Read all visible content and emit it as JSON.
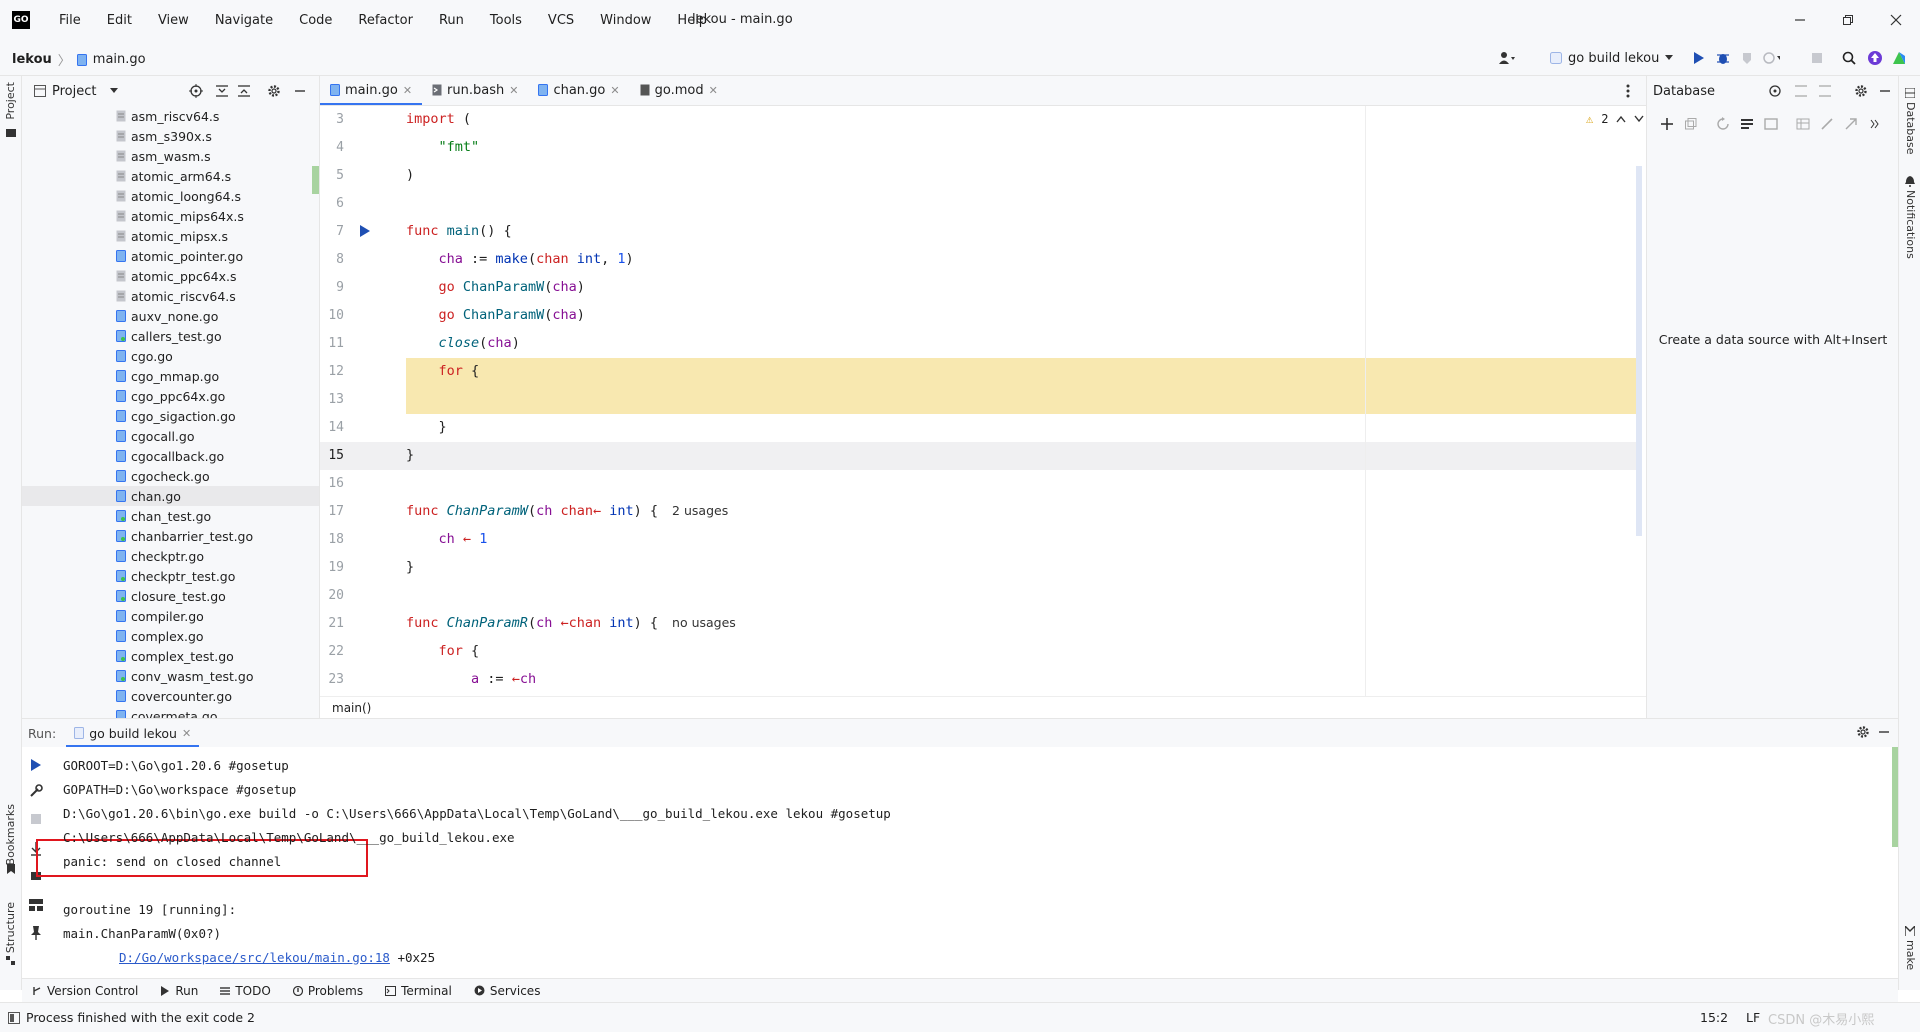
{
  "menu": {
    "items": [
      "File",
      "Edit",
      "View",
      "Navigate",
      "Code",
      "Refactor",
      "Run",
      "Tools",
      "VCS",
      "Window",
      "Help"
    ],
    "logo_text": "GO"
  },
  "window": {
    "title": "lekou - main.go"
  },
  "navbar": {
    "project": "lekou",
    "file": "main.go",
    "run_config": "go build lekou"
  },
  "stripes": {
    "left_top": "Project",
    "left_bookmarks": "Bookmarks",
    "left_structure": "Structure",
    "right_database": "Database",
    "right_notifications": "Notifications",
    "right_make": "make"
  },
  "project_panel": {
    "title": "Project",
    "files": [
      "asm_riscv64.s",
      "asm_s390x.s",
      "asm_wasm.s",
      "atomic_arm64.s",
      "atomic_loong64.s",
      "atomic_mips64x.s",
      "atomic_mipsx.s",
      "atomic_pointer.go",
      "atomic_ppc64x.s",
      "atomic_riscv64.s",
      "auxv_none.go",
      "callers_test.go",
      "cgo.go",
      "cgo_mmap.go",
      "cgo_ppc64x.go",
      "cgo_sigaction.go",
      "cgocall.go",
      "cgocallback.go",
      "cgocheck.go",
      "chan.go",
      "chan_test.go",
      "chanbarrier_test.go",
      "checkptr.go",
      "checkptr_test.go",
      "closure_test.go",
      "compiler.go",
      "complex.go",
      "complex_test.go",
      "conv_wasm_test.go",
      "covercounter.go",
      "covermeta.go"
    ],
    "selected": "chan.go"
  },
  "editor": {
    "tabs": [
      "main.go",
      "run.bash",
      "chan.go",
      "go.mod"
    ],
    "active_tab": "main.go",
    "warnings": "2",
    "line_numbers": [
      "3",
      "4",
      "5",
      "6",
      "7",
      "8",
      "9",
      "10",
      "11",
      "12",
      "13",
      "14",
      "15",
      "16",
      "17",
      "18",
      "19",
      "20",
      "21",
      "22",
      "23"
    ],
    "current_line": "15",
    "breadcrumb": "main()",
    "hints": {
      "usages_w": "2 usages",
      "usages_r": "no usages"
    }
  },
  "database": {
    "title": "Database",
    "empty_text": "Create a data source with Alt+Insert"
  },
  "run_panel": {
    "label": "Run:",
    "tab": "go build lekou",
    "lines": [
      "GOROOT=D:\\Go\\go1.20.6 #gosetup",
      "GOPATH=D:\\Go\\workspace #gosetup",
      "D:\\Go\\go1.20.6\\bin\\go.exe build -o C:\\Users\\666\\AppData\\Local\\Temp\\GoLand\\___go_build_lekou.exe lekou #gosetup",
      "C:\\Users\\666\\AppData\\Local\\Temp\\GoLand\\___go_build_lekou.exe",
      "panic: send on closed channel",
      "",
      "goroutine 19 [running]:",
      "main.ChanParamW(0x0?)"
    ],
    "trace_link": "D:/Go/workspace/src/lekou/main.go:18",
    "trace_offset": " +0x25"
  },
  "tool_tabs": [
    "Version Control",
    "Run",
    "TODO",
    "Problems",
    "Terminal",
    "Services"
  ],
  "status": {
    "text": "Process finished with the exit code 2",
    "position": "15:2",
    "line_sep": "LF",
    "watermark": "CSDN @木易小熙"
  },
  "colors": {
    "accent": "#3574f0",
    "highlight": "#f8e8b0",
    "panic_box": "#e0161e"
  }
}
